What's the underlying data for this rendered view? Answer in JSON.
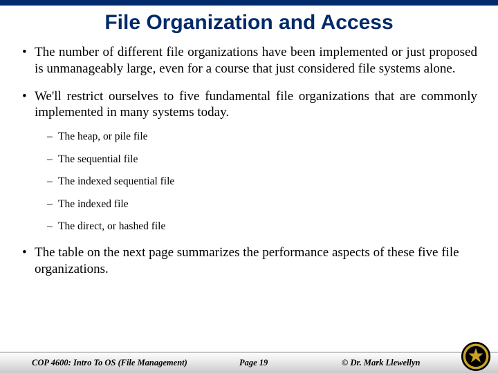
{
  "title": "File Organization and Access",
  "bullets": [
    "The number of different file organizations have been implemented or just proposed is unmanageably large, even for a course that just considered file systems alone.",
    "We'll restrict ourselves to five fundamental file organizations that are commonly implemented in many systems today."
  ],
  "subbullets": [
    "The heap, or pile file",
    "The sequential file",
    "The indexed sequential file",
    "The indexed file",
    "The direct, or hashed file"
  ],
  "bullets_after": [
    "The table on the next page summarizes the performance aspects of these five file organizations."
  ],
  "footer": {
    "course": "COP 4600: Intro To OS  (File Management)",
    "page": "Page 19",
    "copyright": "© Dr. Mark Llewellyn"
  }
}
